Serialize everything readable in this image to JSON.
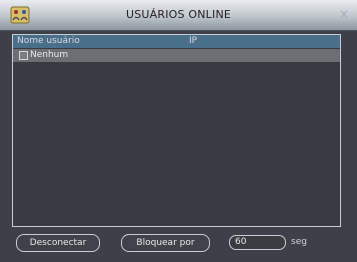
{
  "window": {
    "title": "USUÁRIOS ONLINE",
    "close_glyph": "×",
    "icon": "network-users-icon"
  },
  "table": {
    "headers": [
      "Nome usuário",
      "IP"
    ],
    "rows": [
      {
        "name": "Nenhum",
        "ip": "",
        "checked": false
      }
    ]
  },
  "actions": {
    "disconnect_label": "Desconectar",
    "block_label": "Bloquear por",
    "block_value": "60",
    "block_unit": "seg"
  }
}
